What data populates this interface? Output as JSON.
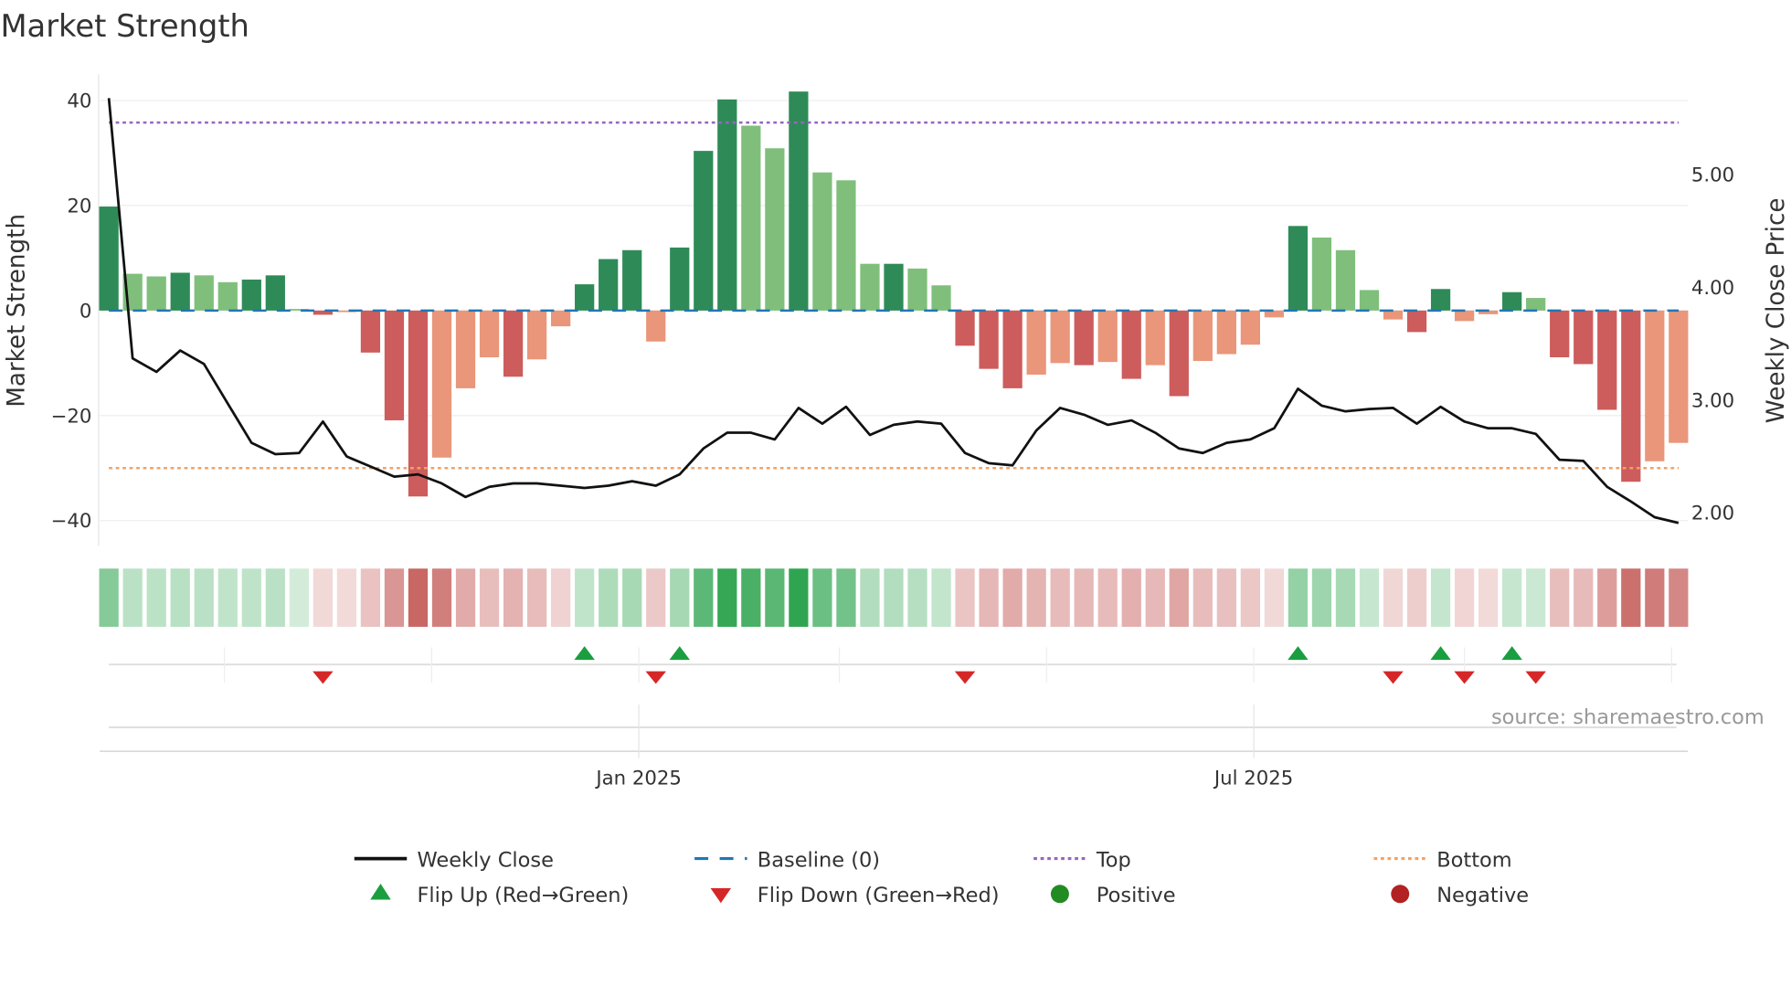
{
  "chart_data": {
    "type": "bar",
    "title": "Market Strength",
    "ylabel": "Market Strength",
    "y2label": "Weekly Close Price",
    "ylim": [
      -45,
      45
    ],
    "y2lim": [
      1.71,
      5.89
    ],
    "yticks": [
      "40",
      "20",
      "0",
      "−20",
      "−40"
    ],
    "ytick_values": [
      40,
      20,
      0,
      -20,
      -40
    ],
    "y2ticks": [
      "5.00",
      "4.00",
      "3.00",
      "2.00"
    ],
    "y2tick_values": [
      5,
      4,
      3,
      2
    ],
    "xticks": [
      {
        "label": "Jan 2025",
        "date": "2025-01-01"
      },
      {
        "label": "Jul 2025",
        "date": "2025-07-01"
      }
    ],
    "grid": true,
    "legend_placement": "bottom",
    "x": [
      "2024-07-29",
      "2024-08-05",
      "2024-08-12",
      "2024-08-19",
      "2024-08-26",
      "2024-09-02",
      "2024-09-09",
      "2024-09-16",
      "2024-09-23",
      "2024-09-30",
      "2024-10-07",
      "2024-10-14",
      "2024-10-21",
      "2024-10-28",
      "2024-11-04",
      "2024-11-11",
      "2024-11-18",
      "2024-11-25",
      "2024-12-02",
      "2024-12-09",
      "2024-12-16",
      "2024-12-23",
      "2024-12-30",
      "2025-01-06",
      "2025-01-13",
      "2025-01-20",
      "2025-01-27",
      "2025-02-03",
      "2025-02-10",
      "2025-02-17",
      "2025-02-24",
      "2025-03-03",
      "2025-03-10",
      "2025-03-17",
      "2025-03-24",
      "2025-03-31",
      "2025-04-07",
      "2025-04-14",
      "2025-04-21",
      "2025-04-28",
      "2025-05-05",
      "2025-05-12",
      "2025-05-19",
      "2025-05-26",
      "2025-06-02",
      "2025-06-09",
      "2025-06-16",
      "2025-06-23",
      "2025-06-30",
      "2025-07-07",
      "2025-07-14",
      "2025-07-21",
      "2025-07-28",
      "2025-08-04",
      "2025-08-11",
      "2025-08-18",
      "2025-08-25",
      "2025-09-01",
      "2025-09-08",
      "2025-09-15",
      "2025-09-22",
      "2025-09-29",
      "2025-10-06",
      "2025-10-13",
      "2025-10-20",
      "2025-10-27",
      "2025-11-03"
    ],
    "series": [
      {
        "name": "Market Strength",
        "type": "bar",
        "values": [
          19.8,
          7.0,
          6.5,
          7.2,
          6.7,
          5.4,
          5.9,
          6.7,
          0.3,
          -0.8,
          -0.3,
          -8.0,
          -20.9,
          -35.4,
          -28.0,
          -14.8,
          -8.9,
          -12.6,
          -9.3,
          -3.0,
          5.0,
          9.8,
          11.5,
          -5.9,
          12.0,
          30.4,
          40.2,
          35.2,
          30.9,
          41.7,
          26.3,
          24.8,
          8.9,
          8.9,
          8.0,
          4.8,
          -6.7,
          -11.1,
          -14.8,
          -12.2,
          -10.0,
          -10.4,
          -9.8,
          -13.0,
          -10.4,
          -16.3,
          -9.6,
          -8.3,
          -6.5,
          -1.3,
          16.1,
          13.9,
          11.5,
          3.9,
          -1.7,
          -4.1,
          4.1,
          -2.0,
          -0.7,
          3.5,
          2.4,
          -8.9,
          -10.2,
          -18.9,
          -32.6,
          -28.7,
          -25.2
        ]
      },
      {
        "name": "Weekly Close",
        "type": "line",
        "axis": "right",
        "values": [
          5.68,
          3.37,
          3.25,
          3.44,
          3.32,
          2.97,
          2.62,
          2.52,
          2.53,
          2.81,
          2.5,
          2.41,
          2.32,
          2.34,
          2.26,
          2.14,
          2.23,
          2.26,
          2.26,
          2.24,
          2.22,
          2.24,
          2.28,
          2.24,
          2.34,
          2.57,
          2.71,
          2.71,
          2.65,
          2.93,
          2.79,
          2.94,
          2.69,
          2.78,
          2.81,
          2.79,
          2.53,
          2.44,
          2.42,
          2.73,
          2.93,
          2.87,
          2.78,
          2.82,
          2.71,
          2.57,
          2.53,
          2.62,
          2.65,
          2.75,
          3.1,
          2.95,
          2.9,
          2.92,
          2.93,
          2.79,
          2.94,
          2.81,
          2.75,
          2.75,
          2.7,
          2.47,
          2.46,
          2.23,
          2.1,
          1.96,
          1.91
        ]
      }
    ],
    "baseline": 0,
    "top": 35.8,
    "bottom": -30,
    "flip_up_dates": [
      "2024-12-16",
      "2025-01-13",
      "2025-07-14",
      "2025-08-25",
      "2025-09-15"
    ],
    "flip_down_dates": [
      "2024-09-30",
      "2025-01-06",
      "2025-04-07",
      "2025-08-11",
      "2025-09-01",
      "2025-09-22"
    ],
    "colors": {
      "strong_positive": "#2e8b57",
      "weak_positive": "#7fbf7b",
      "strong_negative": "#cd5c5c",
      "weak_negative": "#e9967a",
      "heat_positive": "#2ea44f",
      "heat_negative": "#c0504d",
      "weekly_close": "#111111",
      "baseline": "#1f77b4",
      "top": "#9467bd",
      "bottom": "#f4a261",
      "flip_up": "#1a9e3f",
      "flip_down": "#d62728",
      "positive": "#228b22",
      "negative": "#b22222"
    },
    "legend": [
      {
        "label": "Weekly Close",
        "icon": "solid-line"
      },
      {
        "label": "Baseline (0)",
        "icon": "dashed-line"
      },
      {
        "label": "Top",
        "icon": "dotted-line"
      },
      {
        "label": "Bottom",
        "icon": "dotted-line"
      },
      {
        "label": "Flip Up (Red→Green)",
        "icon": "triangle-up"
      },
      {
        "label": "Flip Down (Green→Red)",
        "icon": "triangle-down"
      },
      {
        "label": "Positive",
        "icon": "circle"
      },
      {
        "label": "Negative",
        "icon": "circle"
      }
    ],
    "source": "source: sharemaestro.com"
  }
}
